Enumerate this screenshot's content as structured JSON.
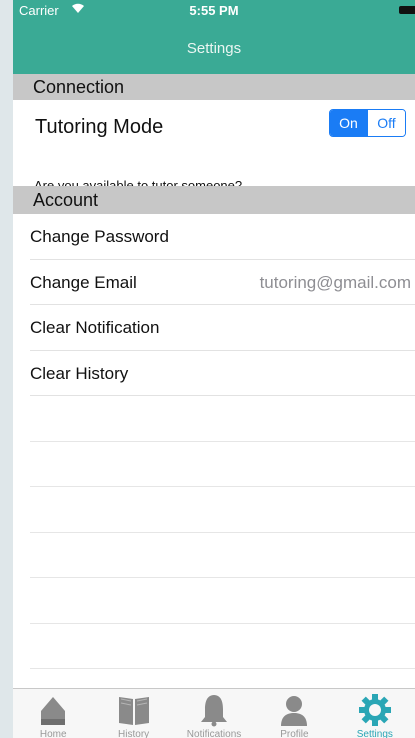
{
  "status": {
    "carrier": "Carrier",
    "time": "5:55 PM"
  },
  "nav": {
    "title": "Settings"
  },
  "sections": {
    "connection": "Connection",
    "account": "Account"
  },
  "tutoring": {
    "label": "Tutoring Mode",
    "toggle_on": "On",
    "toggle_off": "Off",
    "selected": "On",
    "question": "Are you available to tutor someone?"
  },
  "account_rows": [
    {
      "label": "Change Password",
      "value": ""
    },
    {
      "label": "Change Email",
      "value": "tutoring@gmail.com"
    },
    {
      "label": "Clear Notification",
      "value": ""
    },
    {
      "label": "Clear History",
      "value": ""
    }
  ],
  "tabs": [
    {
      "label": "Home",
      "icon": "home-icon"
    },
    {
      "label": "History",
      "icon": "book-icon"
    },
    {
      "label": "Notifications",
      "icon": "bell-icon"
    },
    {
      "label": "Profile",
      "icon": "person-icon"
    },
    {
      "label": "Settings",
      "icon": "gear-icon"
    }
  ],
  "colors": {
    "accent": "#3aaa95",
    "toggle": "#1a7cf5",
    "active_tab": "#2aa6b5"
  }
}
